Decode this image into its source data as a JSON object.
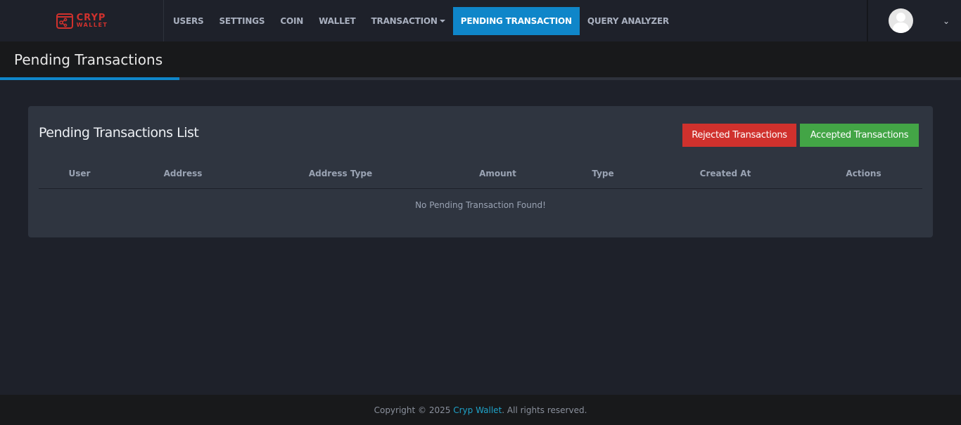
{
  "app": {
    "logo_line1": "CRYP",
    "logo_line2": "WALLET"
  },
  "nav": {
    "items": [
      {
        "label": "USERS"
      },
      {
        "label": "SETTINGS"
      },
      {
        "label": "COIN"
      },
      {
        "label": "WALLET"
      },
      {
        "label": "TRANSACTION"
      },
      {
        "label": "PENDING TRANSACTION"
      },
      {
        "label": "QUERY ANALYZER"
      }
    ]
  },
  "page": {
    "title": "Pending Transactions"
  },
  "card": {
    "title": "Pending Transactions List",
    "rejected_button": "Rejected Transactions",
    "accepted_button": "Accepted Transactions",
    "columns": [
      "User",
      "Address",
      "Address Type",
      "Amount",
      "Type",
      "Created At",
      "Actions"
    ],
    "empty_message": "No Pending Transaction Found!"
  },
  "footer": {
    "prefix": "Copyright © 2025 ",
    "brand": "Cryp Wallet",
    "suffix": ". All rights reserved."
  },
  "colors": {
    "accent": "#0f86c9",
    "danger": "#d0312d",
    "success": "#43a546"
  }
}
